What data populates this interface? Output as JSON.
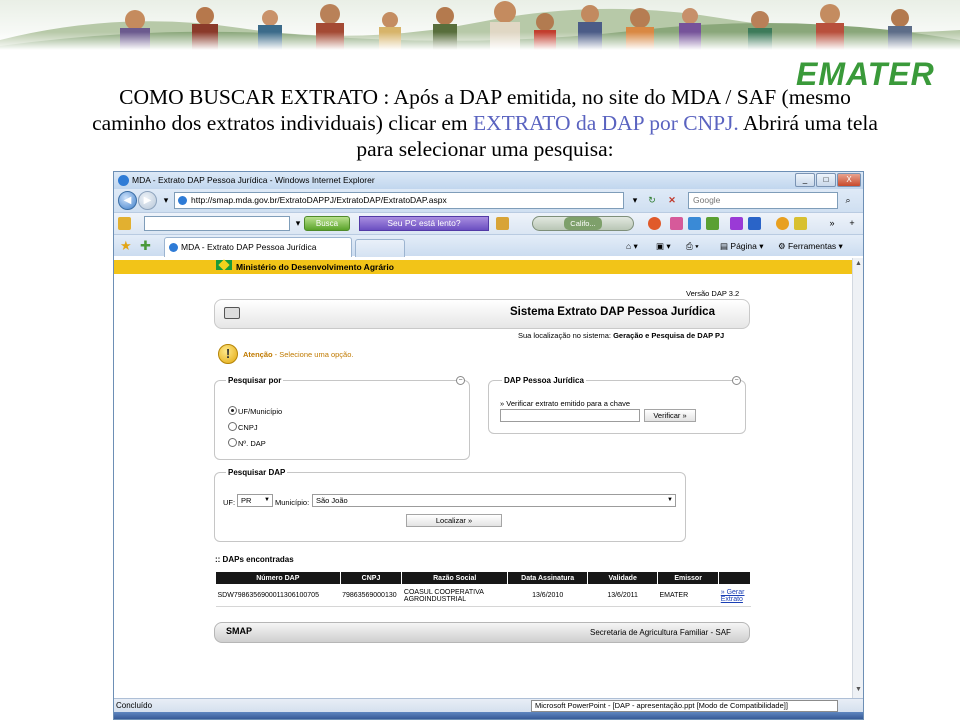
{
  "slide": {
    "logo_text": "EMATER",
    "line1": "COMO BUSCAR EXTRATO :   Após a DAP emitida, no site do MDA / SAF (mesmo",
    "line2_a": "caminho dos extratos individuais) clicar em ",
    "line2_highlight": "EXTRATO da DAP por CNPJ.",
    "line2_b": " Abrirá uma tela",
    "line3": "para selecionar uma pesquisa:",
    "highlight_color": "#5a63c0"
  },
  "browser": {
    "window_title": "MDA - Extrato DAP Pessoa Jurídica - Windows Internet Explorer",
    "window_buttons": [
      "_",
      "□",
      "X"
    ],
    "address": "http://smap.mda.gov.br/ExtratoDAPPJ/ExtratoDAP/ExtratoDAP.aspx",
    "search_placeholder": "Google",
    "busca_label": "Busca",
    "promo_label": "Seu PC está lento?",
    "player_label": "Califo...",
    "tab_title": "MDA - Extrato DAP Pessoa Jurídica",
    "cmd_pagina": "Página",
    "cmd_ferramentas": "Ferramentas",
    "status_text": "Concluído",
    "taskbar_tooltip": "Microsoft PowerPoint - [DAP - apresentação.ppt [Modo de Compatibilidade]]"
  },
  "page": {
    "ministry": "Ministério do Desenvolvimento Agrário",
    "versao": "Versão DAP 3.2",
    "system_title": "Sistema Extrato DAP Pessoa Jurídica",
    "localizacao_label": "Sua localização no sistema:",
    "localizacao_value": "Geração e Pesquisa de DAP PJ",
    "atencao_label": "Atenção",
    "atencao_text": " - Selecione uma opção.",
    "pesquisar_por": {
      "legend": "Pesquisar por",
      "options": [
        "UF/Município",
        "CNPJ",
        "Nº. DAP"
      ],
      "selected": "UF/Município"
    },
    "dap_pj": {
      "legend": "DAP Pessoa Jurídica",
      "hint": "» Verificar extrato emitido para a chave",
      "button": "Verificar »"
    },
    "pesquisar_dap": {
      "legend": "Pesquisar DAP",
      "uf_label": "UF:",
      "uf_value": "PR",
      "municipio_label": "Município:",
      "municipio_value": "São João",
      "button": "Localizar »"
    },
    "results": {
      "title": ":: DAPs encontradas",
      "headers": [
        "Número DAP",
        "CNPJ",
        "Razão Social",
        "Data Assinatura",
        "Validade",
        "Emissor",
        ""
      ],
      "rows": [
        [
          "SDW7986356900011306100705",
          "79863569000130",
          "COASUL COOPERATIVA AGROINDUSTRIAL",
          "13/6/2010",
          "13/6/2011",
          "EMATER",
          "» Gerar Extrato"
        ]
      ]
    },
    "footer": {
      "smap": "SMAP",
      "secretaria": "Secretaria de Agricultura Familiar - SAF"
    }
  }
}
